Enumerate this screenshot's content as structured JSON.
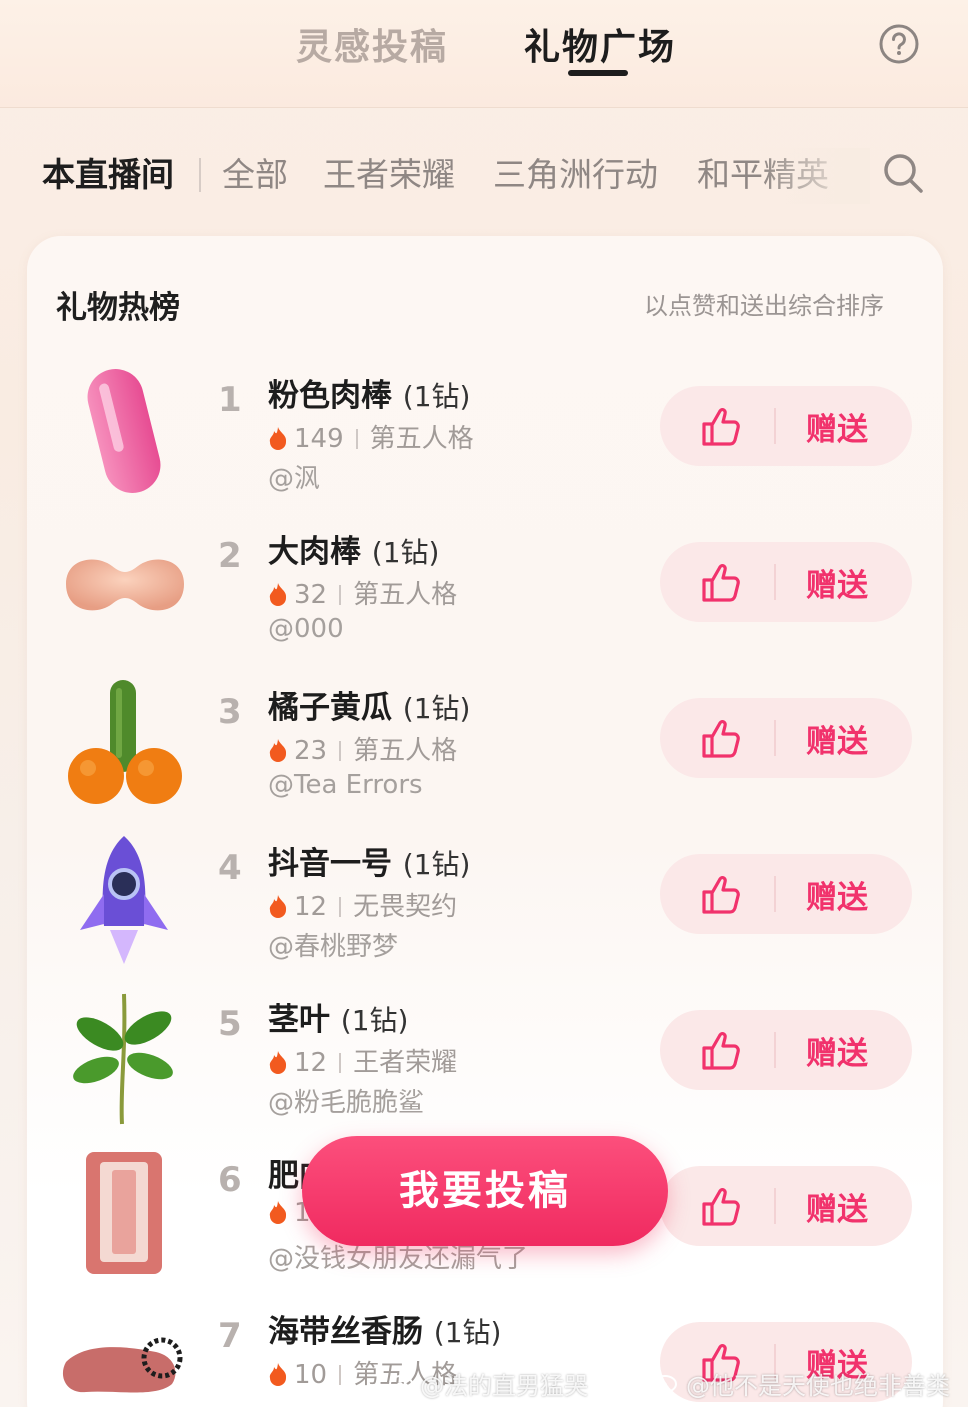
{
  "header": {
    "tabs": [
      {
        "label": "灵感投稿",
        "active": false
      },
      {
        "label": "礼物广场",
        "active": true
      }
    ],
    "help_icon": "question-circle-icon"
  },
  "categories": {
    "items": [
      {
        "label": "本直播间",
        "active": true
      },
      {
        "label": "全部",
        "active": false
      },
      {
        "label": "王者荣耀",
        "active": false
      },
      {
        "label": "三角洲行动",
        "active": false
      },
      {
        "label": "和平精英",
        "active": false
      }
    ],
    "search_icon": "search-icon"
  },
  "board": {
    "title": "礼物热榜",
    "subtitle": "以点赞和送出综合排序",
    "like_icon": "thumbs-up-icon",
    "send_label": "赠送",
    "colors": {
      "accent": "#f1326c",
      "pill": "#fbe8e8"
    },
    "gifts": [
      {
        "rank": "1",
        "name": "粉色肉棒",
        "price": "(1钻)",
        "heat": "149",
        "game": "第五人格",
        "author": "@沨",
        "image": "pink-capsule"
      },
      {
        "rank": "2",
        "name": "大肉棒",
        "price": "(1钻)",
        "heat": "32",
        "game": "第五人格",
        "author": "@000",
        "image": "flesh-blob"
      },
      {
        "rank": "3",
        "name": "橘子黄瓜",
        "price": "(1钻)",
        "heat": "23",
        "game": "第五人格",
        "author": "@Tea Errors",
        "image": "oranges-cucumber"
      },
      {
        "rank": "4",
        "name": "抖音一号",
        "price": "(1钻)",
        "heat": "12",
        "game": "无畏契约",
        "author": "@春桃野梦",
        "image": "rocket"
      },
      {
        "rank": "5",
        "name": "茎叶",
        "price": "(1钻)",
        "heat": "12",
        "game": "王者荣耀",
        "author": "@粉毛脆脆鲨",
        "image": "leaf-stem"
      },
      {
        "rank": "6",
        "name": "肥肉",
        "price": "",
        "heat": "1",
        "game": "",
        "author": "@没钱女朋友还漏气了",
        "image": "pork-belly"
      },
      {
        "rank": "7",
        "name": "海带丝香肠",
        "price": "(1钻)",
        "heat": "10",
        "game": "第五人格",
        "author": "",
        "image": "sausage-seaweed"
      }
    ]
  },
  "submit_button": {
    "label": "我要投稿"
  },
  "watermarks": [
    {
      "text": "@法的直男猛哭"
    },
    {
      "text": "@他不是天使也绝非善类"
    }
  ]
}
